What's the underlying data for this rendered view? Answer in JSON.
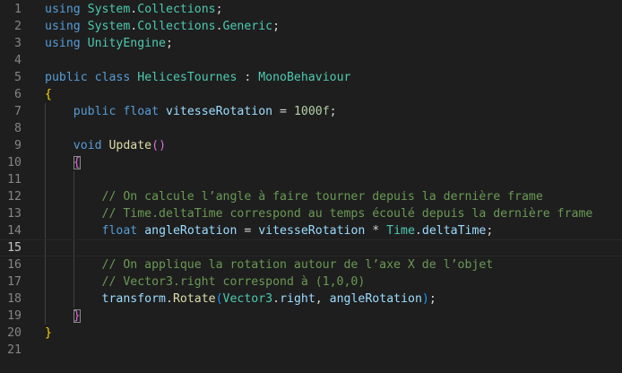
{
  "editor": {
    "active_line": 15,
    "lines": [
      {
        "number": "1",
        "tokens": [
          {
            "t": "using",
            "c": "keyword"
          },
          {
            "t": " ",
            "c": "plain"
          },
          {
            "t": "System",
            "c": "type"
          },
          {
            "t": ".",
            "c": "plain"
          },
          {
            "t": "Collections",
            "c": "type"
          },
          {
            "t": ";",
            "c": "plain"
          }
        ]
      },
      {
        "number": "2",
        "tokens": [
          {
            "t": "using",
            "c": "keyword"
          },
          {
            "t": " ",
            "c": "plain"
          },
          {
            "t": "System",
            "c": "type"
          },
          {
            "t": ".",
            "c": "plain"
          },
          {
            "t": "Collections",
            "c": "type"
          },
          {
            "t": ".",
            "c": "plain"
          },
          {
            "t": "Generic",
            "c": "type"
          },
          {
            "t": ";",
            "c": "plain"
          }
        ]
      },
      {
        "number": "3",
        "tokens": [
          {
            "t": "using",
            "c": "keyword"
          },
          {
            "t": " ",
            "c": "plain"
          },
          {
            "t": "UnityEngine",
            "c": "type"
          },
          {
            "t": ";",
            "c": "plain"
          }
        ]
      },
      {
        "number": "4",
        "tokens": []
      },
      {
        "number": "5",
        "tokens": [
          {
            "t": "public",
            "c": "keyword"
          },
          {
            "t": " ",
            "c": "plain"
          },
          {
            "t": "class",
            "c": "keyword"
          },
          {
            "t": " ",
            "c": "plain"
          },
          {
            "t": "HelicesTournes",
            "c": "type"
          },
          {
            "t": " : ",
            "c": "plain"
          },
          {
            "t": "MonoBehaviour",
            "c": "type"
          }
        ]
      },
      {
        "number": "6",
        "tokens": [
          {
            "t": "{",
            "c": "brace"
          }
        ]
      },
      {
        "number": "7",
        "tokens": [
          {
            "t": "    ",
            "c": "plain"
          },
          {
            "t": "public",
            "c": "keyword"
          },
          {
            "t": " ",
            "c": "plain"
          },
          {
            "t": "float",
            "c": "keyword"
          },
          {
            "t": " ",
            "c": "plain"
          },
          {
            "t": "vitesseRotation",
            "c": "var"
          },
          {
            "t": " = ",
            "c": "plain"
          },
          {
            "t": "1000f",
            "c": "number"
          },
          {
            "t": ";",
            "c": "plain"
          }
        ]
      },
      {
        "number": "8",
        "tokens": []
      },
      {
        "number": "9",
        "tokens": [
          {
            "t": "    ",
            "c": "plain"
          },
          {
            "t": "void",
            "c": "keyword"
          },
          {
            "t": " ",
            "c": "plain"
          },
          {
            "t": "Update",
            "c": "func"
          },
          {
            "t": "()",
            "c": "brace2"
          }
        ]
      },
      {
        "number": "10",
        "tokens": [
          {
            "t": "    ",
            "c": "plain"
          },
          {
            "t": "{",
            "c": "brace2",
            "box": true
          }
        ]
      },
      {
        "number": "11",
        "tokens": []
      },
      {
        "number": "12",
        "tokens": [
          {
            "t": "        ",
            "c": "plain"
          },
          {
            "t": "// On calcule l’angle à faire tourner depuis la dernière frame",
            "c": "comment"
          }
        ]
      },
      {
        "number": "13",
        "tokens": [
          {
            "t": "        ",
            "c": "plain"
          },
          {
            "t": "// Time.deltaTime correspond au temps écoulé depuis la dernière frame",
            "c": "comment"
          }
        ]
      },
      {
        "number": "14",
        "tokens": [
          {
            "t": "        ",
            "c": "plain"
          },
          {
            "t": "float",
            "c": "keyword"
          },
          {
            "t": " ",
            "c": "plain"
          },
          {
            "t": "angleRotation",
            "c": "var"
          },
          {
            "t": " = ",
            "c": "plain"
          },
          {
            "t": "vitesseRotation",
            "c": "var"
          },
          {
            "t": " * ",
            "c": "plain"
          },
          {
            "t": "Time",
            "c": "type"
          },
          {
            "t": ".",
            "c": "plain"
          },
          {
            "t": "deltaTime",
            "c": "var"
          },
          {
            "t": ";",
            "c": "plain"
          }
        ]
      },
      {
        "number": "15",
        "tokens": []
      },
      {
        "number": "16",
        "tokens": [
          {
            "t": "        ",
            "c": "plain"
          },
          {
            "t": "// On applique la rotation autour de l’axe X de l’objet",
            "c": "comment"
          }
        ]
      },
      {
        "number": "17",
        "tokens": [
          {
            "t": "        ",
            "c": "plain"
          },
          {
            "t": "// Vector3.right correspond à (1,0,0)",
            "c": "comment"
          }
        ]
      },
      {
        "number": "18",
        "tokens": [
          {
            "t": "        ",
            "c": "plain"
          },
          {
            "t": "transform",
            "c": "var"
          },
          {
            "t": ".",
            "c": "plain"
          },
          {
            "t": "Rotate",
            "c": "func"
          },
          {
            "t": "(",
            "c": "brace3"
          },
          {
            "t": "Vector3",
            "c": "type"
          },
          {
            "t": ".",
            "c": "plain"
          },
          {
            "t": "right",
            "c": "var"
          },
          {
            "t": ", ",
            "c": "plain"
          },
          {
            "t": "angleRotation",
            "c": "var"
          },
          {
            "t": ")",
            "c": "brace3"
          },
          {
            "t": ";",
            "c": "plain"
          }
        ]
      },
      {
        "number": "19",
        "tokens": [
          {
            "t": "    ",
            "c": "plain"
          },
          {
            "t": "}",
            "c": "brace2",
            "box": true
          }
        ]
      },
      {
        "number": "20",
        "tokens": [
          {
            "t": "}",
            "c": "brace"
          }
        ]
      },
      {
        "number": "21",
        "tokens": []
      }
    ]
  },
  "colors": {
    "background": "#1e1e1e",
    "keyword": "#569cd6",
    "type": "#4ec9b0",
    "function": "#dcdcaa",
    "variable": "#9cdcfe",
    "number": "#b5cea8",
    "comment": "#6a9955",
    "brace_level1": "#ffd700",
    "brace_level2": "#da70d6",
    "brace_level3": "#179fff"
  }
}
